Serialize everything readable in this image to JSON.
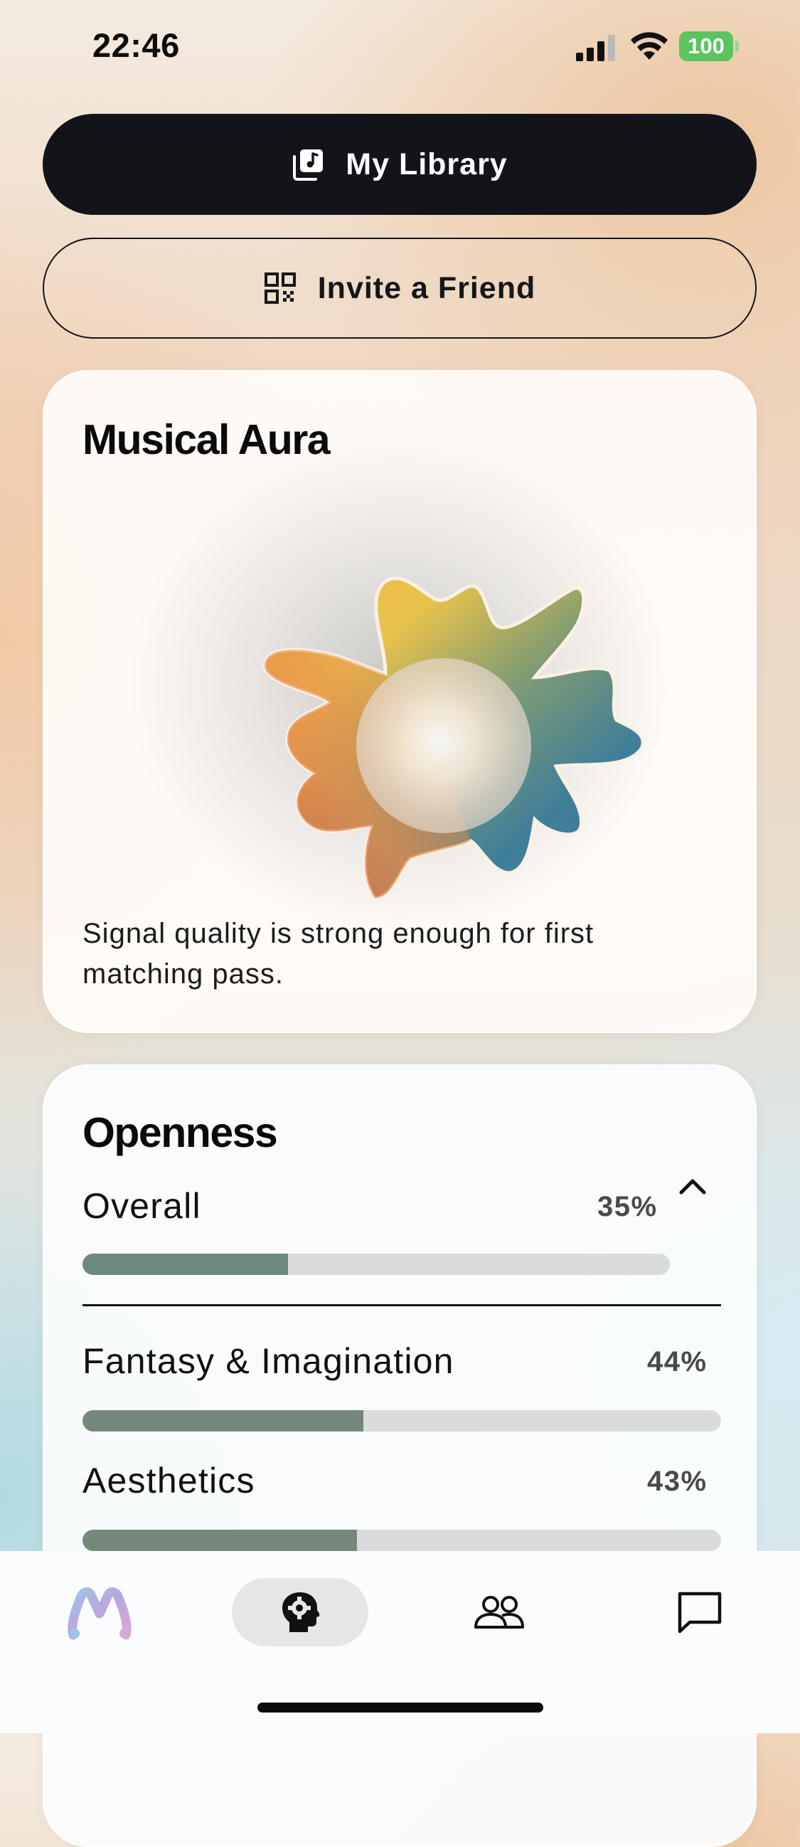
{
  "status_bar": {
    "time": "22:46",
    "battery": "100"
  },
  "actions": {
    "library_label": "My Library",
    "invite_label": "Invite a Friend"
  },
  "aura_card": {
    "title": "Musical Aura",
    "caption": "Signal quality is strong enough for first matching pass."
  },
  "openness_card": {
    "title": "Openness",
    "overall": {
      "label": "Overall",
      "value": "35%",
      "fraction": 0.35
    },
    "facets": [
      {
        "label": "Fantasy & Imagination",
        "value": "44%",
        "fraction": 0.44
      },
      {
        "label": "Aesthetics",
        "value": "43%",
        "fraction": 0.43
      }
    ]
  },
  "tab_bar": {
    "items": [
      "m-logo-icon",
      "head-gear-icon",
      "people-icon",
      "chat-bubble-icon"
    ],
    "active_index": 1
  },
  "colors": {
    "dark_button": "#12141a",
    "bar_fill": "#6c8a80",
    "bar_track": "#dadcdc",
    "battery": "#5bc45f"
  }
}
